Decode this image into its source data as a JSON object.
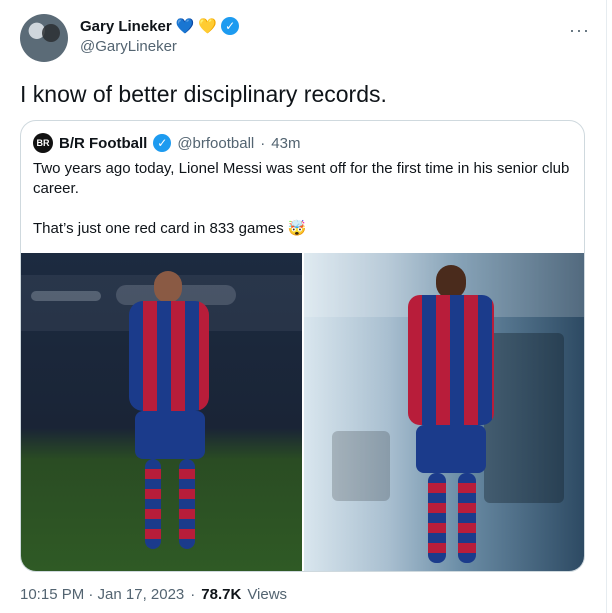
{
  "tweet": {
    "author": {
      "name": "Gary Lineker",
      "handle": "@GaryLineker",
      "hearts": [
        "💙",
        "💛"
      ]
    },
    "text": "I know of better disciplinary records.",
    "more_icon": "more-icon",
    "timestamp": "10:15 PM · Jan 17, 2023",
    "views_count": "78.7K",
    "views_label": "Views"
  },
  "quoted_tweet": {
    "author": {
      "name": "B/R Football",
      "handle": "@brfootball",
      "age": "43m"
    },
    "text": "Two years ago today, Lionel Messi was sent off for the first time in his senior club career.\n\nThat’s just one red card in 833 games 🤯"
  },
  "colors": {
    "text_primary": "#0f1419",
    "text_secondary": "#536471",
    "verified_blue": "#1d9bf0",
    "border": "#cfd9de"
  }
}
